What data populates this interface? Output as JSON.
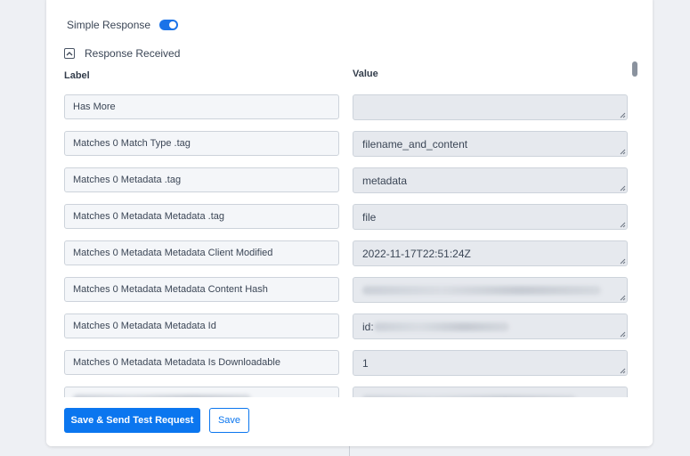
{
  "simple_response": {
    "label": "Simple Response",
    "enabled": true
  },
  "response_received": {
    "label": "Response Received",
    "expanded": true
  },
  "columns": {
    "label": "Label",
    "value": "Value"
  },
  "rows": [
    {
      "label": "Has More",
      "value": ""
    },
    {
      "label": "Matches 0 Match Type .tag",
      "value": "filename_and_content"
    },
    {
      "label": "Matches 0 Metadata .tag",
      "value": "metadata"
    },
    {
      "label": "Matches 0 Metadata Metadata .tag",
      "value": "file"
    },
    {
      "label": "Matches 0 Metadata Metadata Client Modified",
      "value": "2022-11-17T22:51:24Z"
    },
    {
      "label": "Matches 0 Metadata Metadata Content Hash",
      "value": ""
    },
    {
      "label": "Matches 0 Metadata Metadata Id",
      "value": "id:"
    },
    {
      "label": "Matches 0 Metadata Metadata Is Downloadable",
      "value": "1"
    },
    {
      "label": "",
      "value": ""
    }
  ],
  "footer": {
    "save_send_label": "Save & Send Test Request",
    "save_label": "Save"
  },
  "colors": {
    "accent": "#0b76ef",
    "toggle": "#1a73e8"
  },
  "icons": {
    "collapse": "chevron-up-icon",
    "resize": "resize-grip-icon"
  }
}
